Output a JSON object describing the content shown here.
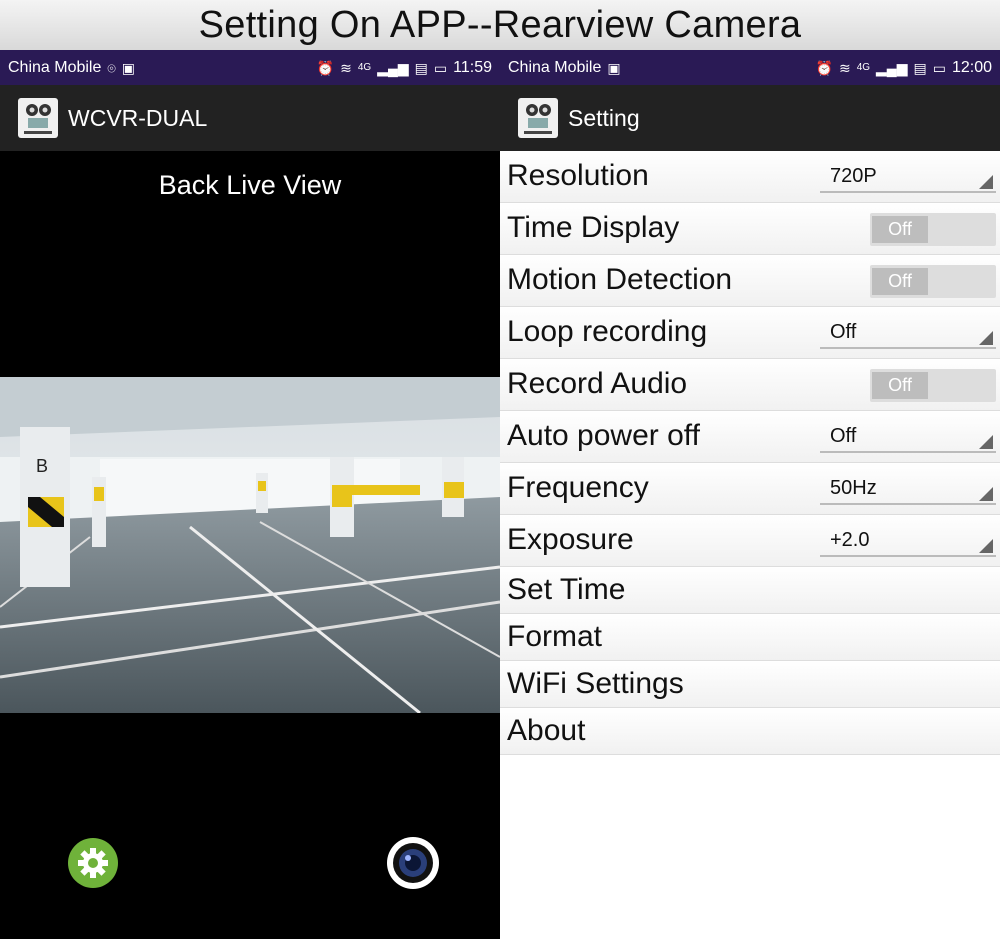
{
  "banner": {
    "title": "Setting On APP--Rearview Camera"
  },
  "left": {
    "status": {
      "carrier": "China Mobile",
      "network": "4G",
      "time": "11:59"
    },
    "appbar": {
      "title": "WCVR-DUAL"
    },
    "live_view_label": "Back Live View",
    "icons": {
      "settings": "gear-icon",
      "capture": "camera-lens-icon"
    }
  },
  "right": {
    "status": {
      "carrier": "China Mobile",
      "network": "4G",
      "time": "12:00"
    },
    "appbar": {
      "title": "Setting"
    },
    "rows": [
      {
        "label": "Resolution",
        "type": "spinner",
        "value": "720P"
      },
      {
        "label": "Time Display",
        "type": "toggle",
        "value": "Off"
      },
      {
        "label": "Motion Detection",
        "type": "toggle",
        "value": "Off"
      },
      {
        "label": "Loop recording",
        "type": "spinner",
        "value": "Off"
      },
      {
        "label": "Record Audio",
        "type": "toggle",
        "value": "Off"
      },
      {
        "label": "Auto power off",
        "type": "spinner",
        "value": "Off"
      },
      {
        "label": "Frequency",
        "type": "spinner",
        "value": "50Hz"
      },
      {
        "label": "Exposure",
        "type": "spinner",
        "value": "+2.0"
      },
      {
        "label": "Set Time",
        "type": "link"
      },
      {
        "label": "Format",
        "type": "link"
      },
      {
        "label": "WiFi Settings",
        "type": "link"
      },
      {
        "label": "About",
        "type": "link"
      }
    ]
  },
  "colors": {
    "status_bar": "#2a1a55",
    "app_bar": "#222222",
    "settings_button": "#6fb23a"
  }
}
